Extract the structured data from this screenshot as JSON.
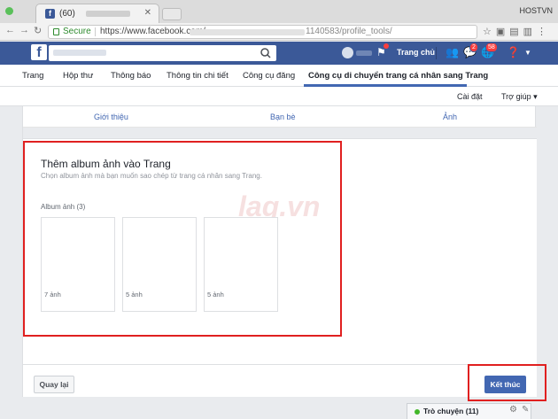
{
  "browser": {
    "tab_title": "(60)",
    "hostname": "HOSTVN",
    "secure_label": "Secure",
    "url_prefix": "https://www.facebook.com/",
    "url_suffix": "1140583/profile_tools/"
  },
  "fb": {
    "logo": "f",
    "home_label": "Trang chủ",
    "friend_badge": "2",
    "notif_badge": "58"
  },
  "page_tabs": [
    {
      "label": "Trang"
    },
    {
      "label": "Hộp thư"
    },
    {
      "label": "Thông báo"
    },
    {
      "label": "Thông tin chi tiết"
    },
    {
      "label": "Công cụ đăng"
    },
    {
      "label": "Công cụ di chuyển trang cá nhân sang Trang"
    }
  ],
  "subnav": {
    "settings": "Cài đặt",
    "help": "Trợ giúp ▾"
  },
  "section_tabs": [
    {
      "label": "Giới thiệu"
    },
    {
      "label": "Bạn bè"
    },
    {
      "label": "Ảnh"
    }
  ],
  "album_panel": {
    "title": "Thêm album ảnh vào Trang",
    "subtitle": "Chọn album ảnh mà bạn muốn sao chép từ trang cá nhân sang Trang.",
    "count_label": "Album ảnh (3)",
    "albums": [
      {
        "label": "7 ảnh"
      },
      {
        "label": "5 ảnh"
      },
      {
        "label": "5 ảnh"
      }
    ],
    "watermark": "lag.vn"
  },
  "footer": {
    "back_label": "Quay lại",
    "finish_label": "Kết thúc"
  },
  "chat": {
    "label": "Trò chuyện (11)"
  },
  "colors": {
    "fb_blue": "#3b5998",
    "primary_button": "#4267b2",
    "highlight": "#e02020"
  }
}
